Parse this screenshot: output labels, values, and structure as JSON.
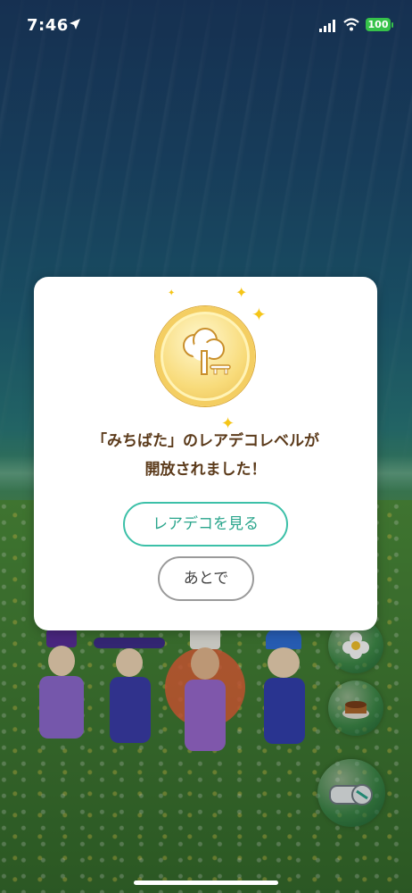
{
  "status_bar": {
    "time": "7:46",
    "battery": "100"
  },
  "dialog": {
    "message_line1": "「みちばた」のレアデコレベルが",
    "message_line2": "開放されました！",
    "primary_button": "レアデコを見る",
    "secondary_button": "あとで"
  },
  "icons": {
    "location": "location-arrow-icon",
    "signal": "cellular-signal-icon",
    "wifi": "wifi-icon",
    "medal": "tree-decoration-icon",
    "bubble1": "flower-icon",
    "bubble2": "cake-icon",
    "bubble3": "whistle-icon"
  },
  "colors": {
    "accent": "#3cc0a8",
    "text_brown": "#5b3a1a",
    "battery": "#36c24a"
  }
}
